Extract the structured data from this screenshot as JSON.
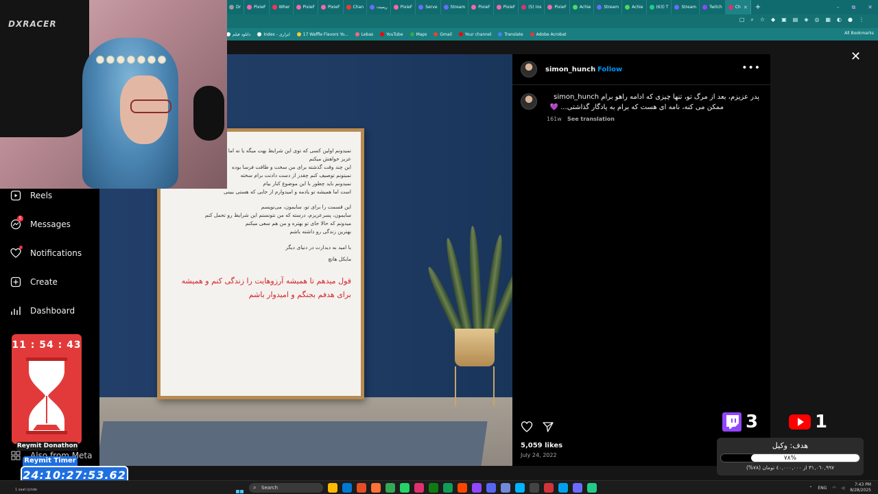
{
  "browser": {
    "tabs": [
      "Dr",
      "PixieF",
      "Wher",
      "PixieF",
      "PixieF",
      "Chan",
      "ریمیت",
      "PixieF",
      "Serve",
      "Stream",
      "PixieF",
      "PixieF",
      "(5) Ins",
      "PixieF",
      "Achie",
      "Stream",
      "Achie",
      "(63) T",
      "Stream",
      "Twitch",
      "Ch"
    ],
    "tab_colors": [
      "#999999",
      "#ff66aa",
      "#ff3355",
      "#ff66aa",
      "#ff66aa",
      "#ff3333",
      "#6b6bff",
      "#ff66aa",
      "#6b6bff",
      "#6b6bff",
      "#ff66aa",
      "#ff66aa",
      "#e1306c",
      "#ff66aa",
      "#4cd964",
      "#6b6bff",
      "#4cd964",
      "#22cc88",
      "#6b6bff",
      "#9146ff",
      "#e1306c"
    ],
    "new_tab": "+",
    "window_controls": [
      "–",
      "⧉",
      "✕"
    ],
    "bookmarks": [
      {
        "label": "دانلود فیلم",
        "color": "#ffffff"
      },
      {
        "label": "Index - ابزاری",
        "color": "#ffffff"
      },
      {
        "label": "17 Waffle Flavors Yo...",
        "color": "#ffcc33"
      },
      {
        "label": "Lebas",
        "color": "#ff6688"
      },
      {
        "label": "YouTube",
        "color": "#ff0000"
      },
      {
        "label": "Maps",
        "color": "#34a853"
      },
      {
        "label": "Gmail",
        "color": "#ea4335"
      },
      {
        "label": "Your channel",
        "color": "#ff0000"
      },
      {
        "label": "Translate",
        "color": "#4285f4"
      },
      {
        "label": "Adobe Acrobat",
        "color": "#e03a3a"
      }
    ],
    "all_bookmarks": "All Bookmarks"
  },
  "sidebar": {
    "items": [
      {
        "label": "Reels",
        "icon": "reels-icon"
      },
      {
        "label": "Messages",
        "icon": "messages-icon",
        "badge": "5"
      },
      {
        "label": "Notifications",
        "icon": "heart-icon"
      },
      {
        "label": "Create",
        "icon": "plus-icon"
      },
      {
        "label": "Dashboard",
        "icon": "dashboard-icon"
      },
      {
        "label": "Also from Meta",
        "icon": "grid-icon"
      }
    ]
  },
  "post": {
    "letter_lines": [
      "نمیدونم اولین کسی که توی این شرایط بهت میگه یا نه اما",
      "عزیز خواهش میکنم",
      "این چند وقت گذشته برای من سخت و طاقت فرسا بوده",
      "نمیتونم توصیف کنم چقدر از دست دادنت برام سخته",
      "نمیدونم باید چطور با این موضوع کنار بیام",
      "است اما همیشه تو یادمه و امیدوارم از جایی که هستی ببینی"
    ],
    "letter_lines_2": [
      "این قسمت را برای تو، سایمون، می‌نویسم",
      "سایمون، پسرعزیزم، درسته که من نتونستم این شرایط رو تحمل کنم",
      "میدونم که حالا جای تو بهتره و من هم سعی میکنم",
      "بهترین زندگی رو داشته باشم"
    ],
    "signature_1": "با امید به دیدارت در دنیای دیگر",
    "signature_2": "مایکل هانچ",
    "red_text": "قول میدهم تا همیشه آرزوهایت را زندگی کنم و همیشه برای هدفم بجنگم و امیدوار باشم"
  },
  "panel": {
    "username": "simon_hunch",
    "dot": "•",
    "follow": "Follow",
    "more": "•••",
    "caption_line1": "پدر عزیزم، بعد از مرگ تو، تنها چیزی که ادامه راهو برام simon_hunch",
    "caption_line2": "ممکن می کنه، نامه ای هست که برام به یادگار گذاشتی... 💜",
    "time_ago": "161w",
    "see_translation": "See translation",
    "likes": "5,059 likes",
    "date": "July 24, 2022",
    "close": "✕"
  },
  "webcam": {
    "chair_brand": "DXRACER"
  },
  "timer": {
    "hourglass_time": "11 : 54 : 43",
    "donathon_label": "Reymit Donathon",
    "timer_label": "Reymit Timer",
    "timer_value": "24:10:27:53.62"
  },
  "counters": {
    "twitch_count": "3",
    "youtube_count": "1",
    "twitch_color": "#9146ff",
    "youtube_color": "#ff0000"
  },
  "goal": {
    "title": "هدف: وکیل",
    "progress_percent": 78,
    "progress_label": "٧٨%",
    "subtitle": "٣١,٠٦٠,٩٩٧ از ٤٠,٠٠٠,٠٠٠ تومان (٧٨%)"
  },
  "taskbar": {
    "left_text": "1 saat içinde",
    "search_placeholder": "Search",
    "app_colors": [
      "#ffb900",
      "#0078d4",
      "#e44d26",
      "#ff7139",
      "#34a853",
      "#25d366",
      "#e1306c",
      "#107c10",
      "#0f9d58",
      "#ff4500",
      "#9146ff",
      "#5865f2",
      "#7289da",
      "#00b4ff",
      "#444444",
      "#d13438",
      "#00a2ed",
      "#6b6bff",
      "#22cc88"
    ],
    "language": "ENG",
    "time": "7:43 PM",
    "date": "8/28/2025"
  }
}
